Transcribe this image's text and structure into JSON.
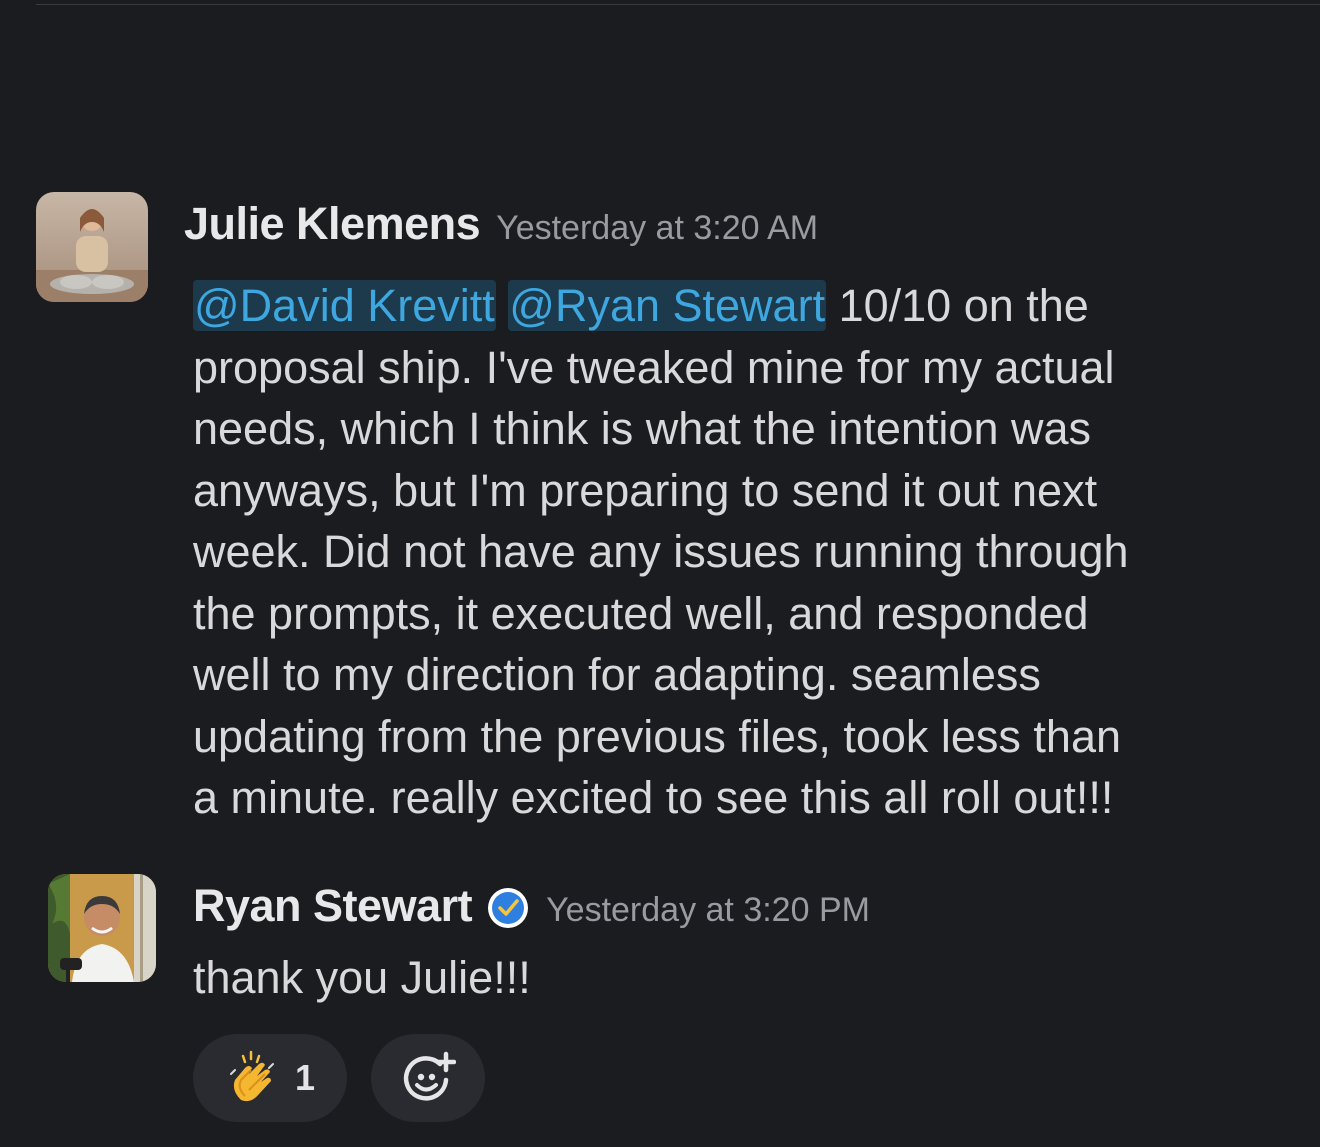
{
  "messages": [
    {
      "author": "Julie Klemens",
      "timestamp": "Yesterday at 3:20 AM",
      "mentions": [
        "@David Krevitt",
        "@Ryan Stewart"
      ],
      "lines": [
        " 10/10 on the",
        "proposal ship. I've tweaked mine for my actual",
        "needs, which I think is what the intention was",
        "anyways, but I'm preparing to send it out next",
        "week. Did not have any issues running through",
        "the prompts, it executed well, and responded",
        "well to my direction for adapting. seamless",
        "updating from the previous files, took less than",
        "a minute. really excited to see this all roll out!!!"
      ]
    },
    {
      "author": "Ryan Stewart",
      "verified": true,
      "timestamp": "Yesterday at 3:20 PM",
      "text": "thank you Julie!!!",
      "reactions": [
        {
          "emoji": "clapping-hands",
          "count": "1"
        }
      ]
    }
  ],
  "colors": {
    "background": "#1b1c20",
    "mention_bg": "#1c3a4b",
    "mention_text": "#3fa7e0",
    "verified": "#2f7fe0",
    "pill_bg": "#2a2b30"
  }
}
